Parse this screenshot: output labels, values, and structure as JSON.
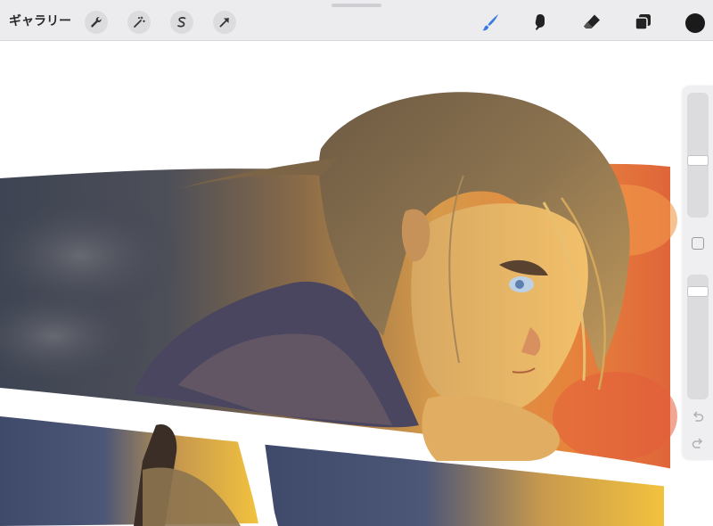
{
  "toolbar": {
    "gallery_label": "ギャラリー",
    "left_tools": [
      "wrench-icon",
      "magic-wand-icon",
      "selection-icon",
      "transform-arrow-icon"
    ],
    "right_tools": [
      "brush-icon",
      "smudge-icon",
      "eraser-icon",
      "layers-icon"
    ],
    "active_tool": "brush-icon",
    "active_color": "#1a1a1a",
    "accent_color": "#3a7be0"
  },
  "sidebar": {
    "brush_size_level": 0.45,
    "opacity_level": 0.1,
    "icons": [
      "modifier-square-icon",
      "undo-icon",
      "redo-icon"
    ]
  },
  "canvas": {
    "artwork": "illustration"
  }
}
